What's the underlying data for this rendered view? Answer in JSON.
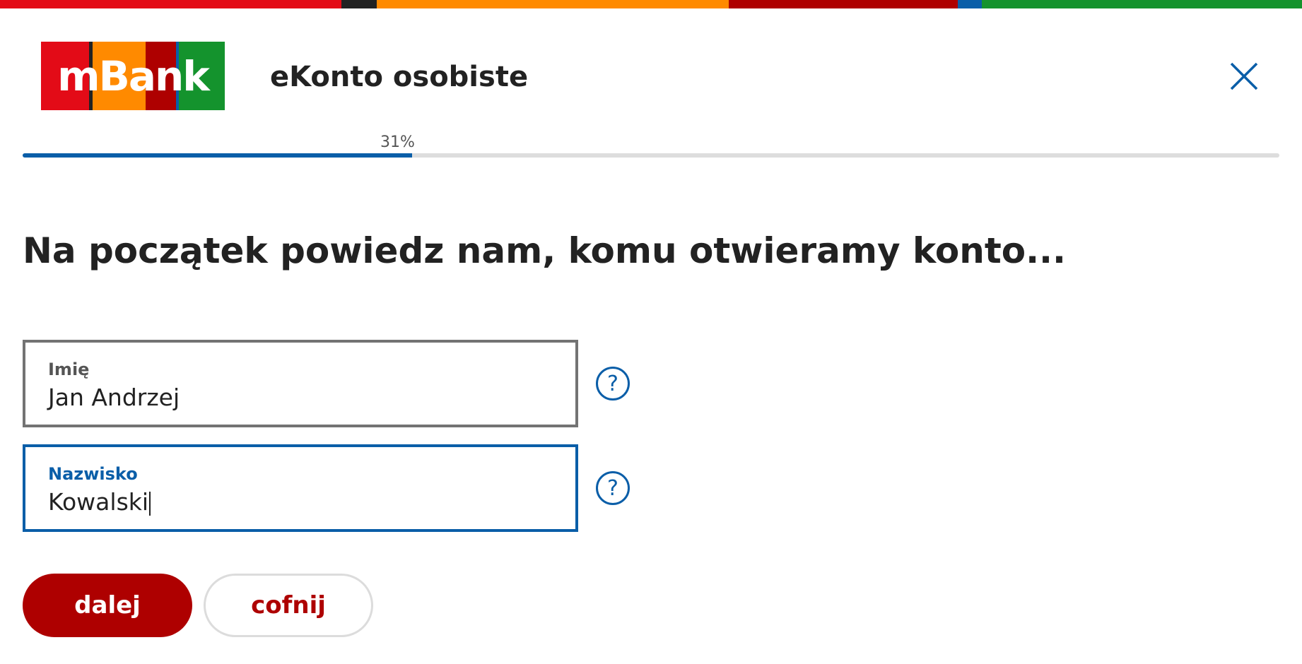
{
  "colors": {
    "stripe": [
      "#e30b17",
      "#222222",
      "#ff8a00",
      "#ae0000",
      "#0a5ea8",
      "#14932d"
    ],
    "logo": [
      "#e30b17",
      "#222222",
      "#ff8a00",
      "#ae0000",
      "#0a5ea8",
      "#14932d"
    ],
    "accent_blue": "#0a5ea8",
    "primary_button": "#ae0000"
  },
  "header": {
    "logo_text": "mBank",
    "title": "eKonto osobiste",
    "close_icon": "close-icon"
  },
  "progress": {
    "label": "31%",
    "value": 0.31
  },
  "main": {
    "heading": "Na początek powiedz nam, komu otwieramy konto..."
  },
  "form": {
    "first_name": {
      "label": "Imię",
      "value": "Jan Andrzej",
      "help_icon": "question-circle-icon"
    },
    "last_name": {
      "label": "Nazwisko",
      "value": "Kowalski",
      "help_icon": "question-circle-icon"
    }
  },
  "actions": {
    "next_label": "dalej",
    "back_label": "cofnij"
  }
}
